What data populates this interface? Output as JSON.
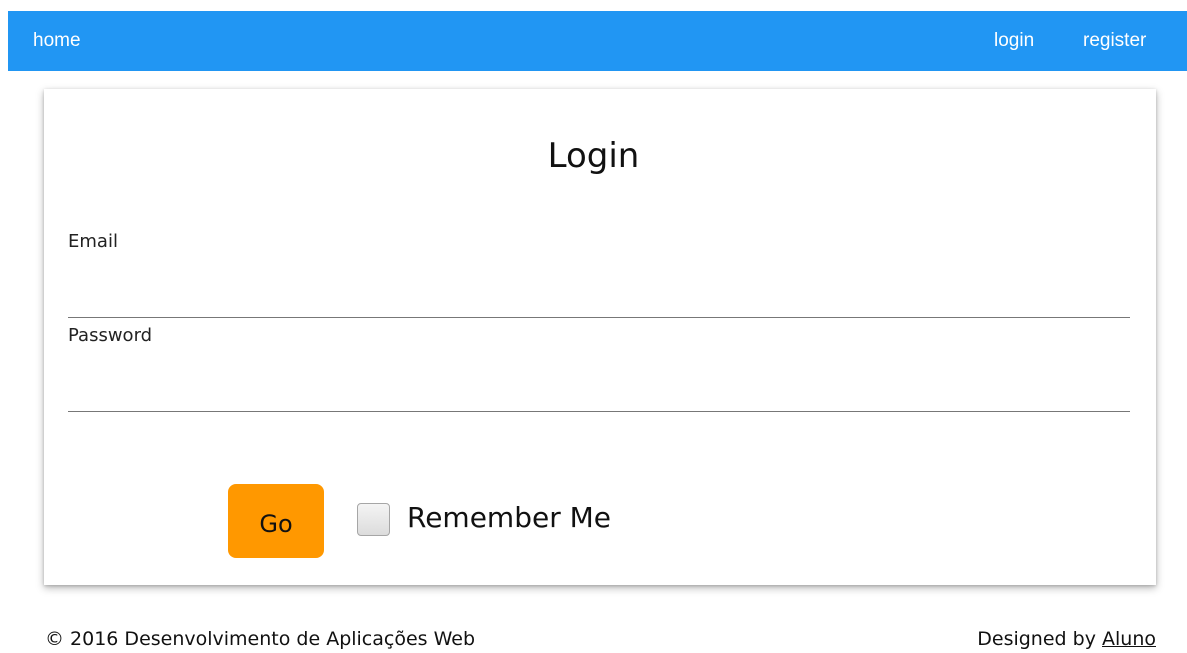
{
  "navbar": {
    "home_label": "home",
    "login_label": "login",
    "register_label": "register",
    "background_color": "#2196f3"
  },
  "login_form": {
    "title": "Login",
    "email_label": "Email",
    "email_value": "",
    "password_label": "Password",
    "password_value": "",
    "submit_label": "Go",
    "submit_color": "#ff9800",
    "remember_label": "Remember Me",
    "remember_checked": false
  },
  "footer": {
    "copyright": "© 2016 Desenvolvimento de Aplicações Web",
    "designed_by_prefix": "Designed by",
    "designer_link": "Aluno"
  }
}
